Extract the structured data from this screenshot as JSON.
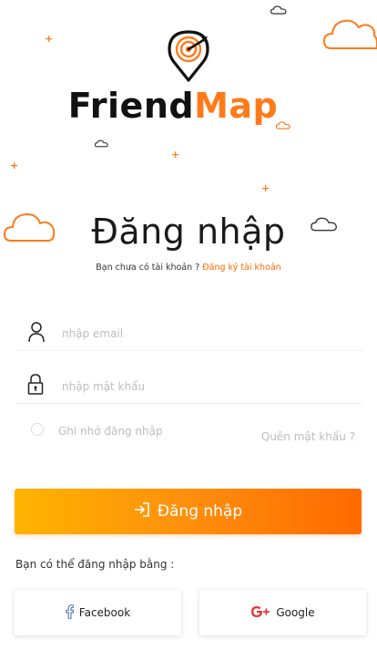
{
  "brand": {
    "name_part1": "Friend",
    "name_part2": "Map"
  },
  "colors": {
    "accent": "#ff7a1a",
    "gradient_start": "#ffb300",
    "gradient_end": "#ff6a00",
    "facebook_icon": "#4267b2",
    "google_icon": "#e53935"
  },
  "login": {
    "title": "Đăng nhập",
    "subtitle_prefix": "Bạn chưa có tài khoản ?",
    "register_link": "Đăng ký tài khoản",
    "email_placeholder": "nhập email",
    "password_placeholder": "nhập mật khẩu",
    "remember_label": "Ghi nhớ đăng nhập",
    "forgot_label": "Quên mật khẩu ?",
    "submit_label": "Đăng nhập",
    "alt_label": "Bạn có thể đăng nhập bằng :"
  },
  "social": {
    "facebook_label": "Facebook",
    "google_label": "Google",
    "facebook_icon": "facebook-icon",
    "google_icon": "google-plus-icon"
  },
  "icons": {
    "email": "user-icon",
    "password": "lock-icon",
    "submit": "login-arrow-icon"
  }
}
